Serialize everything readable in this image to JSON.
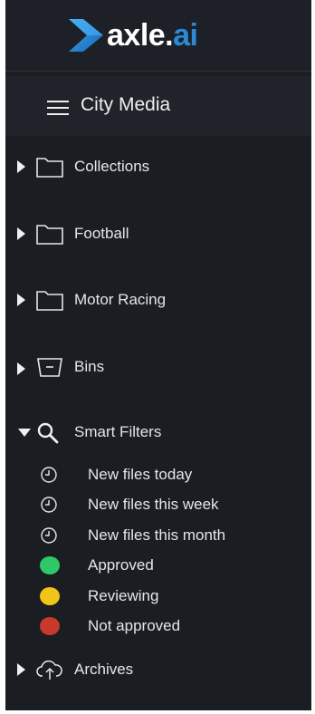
{
  "logo": {
    "main": "axle.",
    "accent": "ai"
  },
  "header": {
    "title": "City Media"
  },
  "tree": [
    {
      "label": "Collections",
      "icon": "folder-icon"
    },
    {
      "label": "Football",
      "icon": "folder-icon"
    },
    {
      "label": "Motor Racing",
      "icon": "folder-icon"
    },
    {
      "label": "Bins",
      "icon": "bin-icon"
    },
    {
      "label": "Smart Filters",
      "icon": "search-icon",
      "expanded": true
    }
  ],
  "smart_filters": [
    {
      "label": "New files today",
      "icon": "clock-icon"
    },
    {
      "label": "New files this week",
      "icon": "clock-icon"
    },
    {
      "label": "New files this month",
      "icon": "clock-icon"
    },
    {
      "label": "Approved",
      "color": "#2ec866"
    },
    {
      "label": "Reviewing",
      "color": "#f2c318"
    },
    {
      "label": "Not approved",
      "color": "#c8392b"
    }
  ],
  "archives": {
    "label": "Archives",
    "icon": "cloud-upload-icon"
  },
  "colors": {
    "accent": "#2b8ad8",
    "panel": "#1a1d22",
    "header": "#202329"
  }
}
